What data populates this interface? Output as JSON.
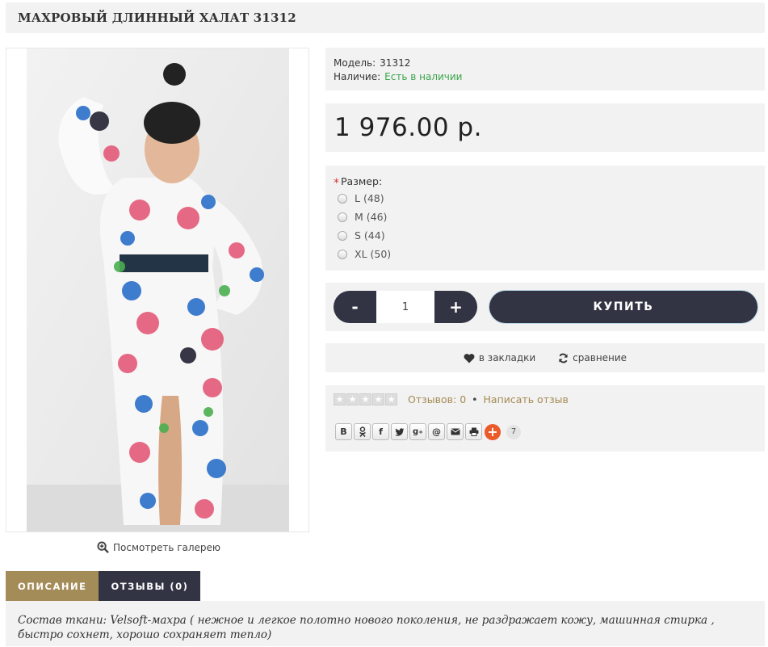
{
  "product": {
    "title": "МАХРОВЫЙ ДЛИННЫЙ ХАЛАТ 31312",
    "gallery_link": "Посмотреть галерею",
    "model_label": "Модель:",
    "model_value": "31312",
    "stock_label": "Наличие:",
    "stock_value": "Есть в наличии",
    "price": "1 976.00 р."
  },
  "options": {
    "required_mark": "*",
    "label": "Размер:",
    "sizes": [
      "L (48)",
      "M (46)",
      "S (44)",
      "XL (50)"
    ]
  },
  "cart": {
    "minus": "-",
    "quantity": "1",
    "plus": "+",
    "buy_label": "КУПИТЬ"
  },
  "links": {
    "wishlist": "в закладки",
    "compare": "сравнение"
  },
  "reviews": {
    "count_text": "Отзывов: 0",
    "separator": "•",
    "write_text": "Написать отзыв"
  },
  "share": {
    "buttons": [
      "В",
      "ok",
      "f",
      "tw",
      "g+",
      "@",
      "mail",
      "print"
    ],
    "plus": "+",
    "count": "7"
  },
  "tabs": {
    "description": "ОПИСАНИЕ",
    "reviews": "ОТЗЫВЫ (0)"
  },
  "description": {
    "text": "Состав ткани: Velsoft-махра ( нежное и легкое полотно нового поколения, не раздражает кожу, машинная стирка , быстро сохнет, хорошо сохраняет тепло)"
  },
  "colors": {
    "accent_gold": "#a48c58",
    "dark_button": "#323443",
    "in_stock_green": "#3aa54a",
    "panel_bg": "#f2f2f2"
  }
}
